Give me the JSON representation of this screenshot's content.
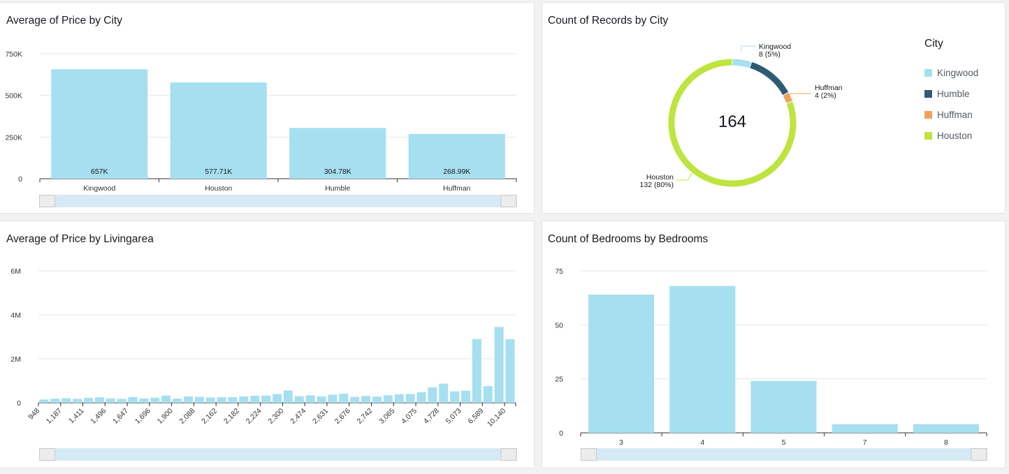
{
  "colors": {
    "bar": "#a6dff0",
    "kingwood": "#a6dff0",
    "humble": "#2f5a73",
    "huffman": "#f1a15b",
    "houston": "#bee43f"
  },
  "chart_data": [
    {
      "type": "bar",
      "title": "Average of Price by City",
      "categories": [
        "Kingwood",
        "Houston",
        "Humble",
        "Huffman"
      ],
      "values": [
        657000,
        577710,
        304780,
        268990
      ],
      "data_labels": [
        "657K",
        "577.71K",
        "304.78K",
        "268.99K"
      ],
      "yticks": [
        "0",
        "250K",
        "500K",
        "750K"
      ],
      "ylim": [
        0,
        750000
      ],
      "grid": true
    },
    {
      "type": "pie",
      "title": "Count of Records by City",
      "total": "164",
      "legend_title": "City",
      "legend_position": "right",
      "slices": [
        {
          "name": "Kingwood",
          "value": 8,
          "label": "8 (5%)"
        },
        {
          "name": "Humble",
          "value": 20,
          "label": ""
        },
        {
          "name": "Huffman",
          "value": 4,
          "label": "4 (2%)"
        },
        {
          "name": "Houston",
          "value": 132,
          "label": "132 (80%)"
        }
      ]
    },
    {
      "type": "bar",
      "title": "Average of Price by Livingarea",
      "tick_labels": [
        "948",
        "1,187",
        "1,411",
        "1,496",
        "1,647",
        "1,696",
        "1,900",
        "2,088",
        "2,162",
        "2,182",
        "2,224",
        "2,300",
        "2,474",
        "2,631",
        "2,676",
        "2,742",
        "3,065",
        "4,075",
        "4,728",
        "5,073",
        "6,589",
        "10,140"
      ],
      "values": [
        150000,
        190000,
        210000,
        180000,
        220000,
        250000,
        200000,
        180000,
        260000,
        200000,
        230000,
        330000,
        190000,
        290000,
        270000,
        240000,
        260000,
        250000,
        290000,
        320000,
        330000,
        400000,
        560000,
        300000,
        340000,
        290000,
        370000,
        410000,
        270000,
        310000,
        280000,
        340000,
        390000,
        400000,
        480000,
        700000,
        870000,
        520000,
        550000,
        2900000,
        760000,
        3450000,
        2900000
      ],
      "yticks": [
        "0",
        "2M",
        "4M",
        "6M"
      ],
      "ylim": [
        0,
        6000000
      ],
      "grid": true
    },
    {
      "type": "bar",
      "title": "Count of Bedrooms by Bedrooms",
      "categories": [
        "3",
        "4",
        "5",
        "7",
        "8"
      ],
      "values": [
        64,
        68,
        24,
        4,
        4
      ],
      "yticks": [
        "0",
        "25",
        "50",
        "75"
      ],
      "ylim": [
        0,
        75
      ],
      "grid": true
    }
  ]
}
